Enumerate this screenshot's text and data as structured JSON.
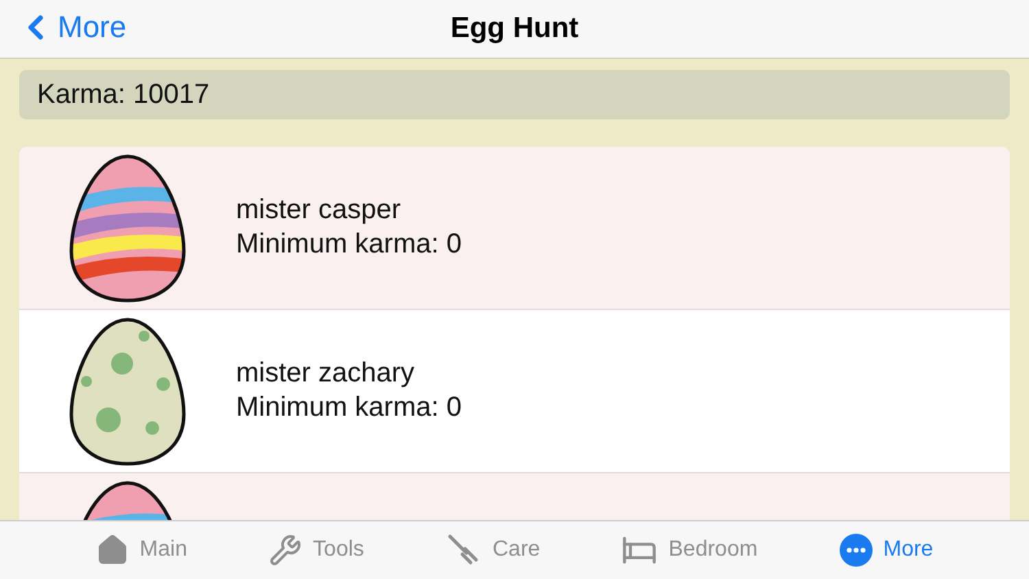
{
  "nav": {
    "back": "More",
    "title": "Egg Hunt"
  },
  "karma": "Karma: 10017",
  "eggs": [
    {
      "kind": "striped",
      "name": "mister casper",
      "requirement": "Minimum karma: 0",
      "selected": true
    },
    {
      "kind": "spotted",
      "name": "mister zachary",
      "requirement": "Minimum karma: 0",
      "selected": false
    },
    {
      "kind": "striped",
      "selected": true
    }
  ],
  "tabs": [
    {
      "kind": "house",
      "label": "Main",
      "selected": false
    },
    {
      "kind": "tools",
      "label": "Tools",
      "selected": false
    },
    {
      "kind": "fork",
      "label": "Care",
      "selected": false
    },
    {
      "kind": "bed",
      "label": "Bedroom",
      "selected": false
    },
    {
      "kind": "more",
      "label": "More",
      "selected": true
    }
  ]
}
